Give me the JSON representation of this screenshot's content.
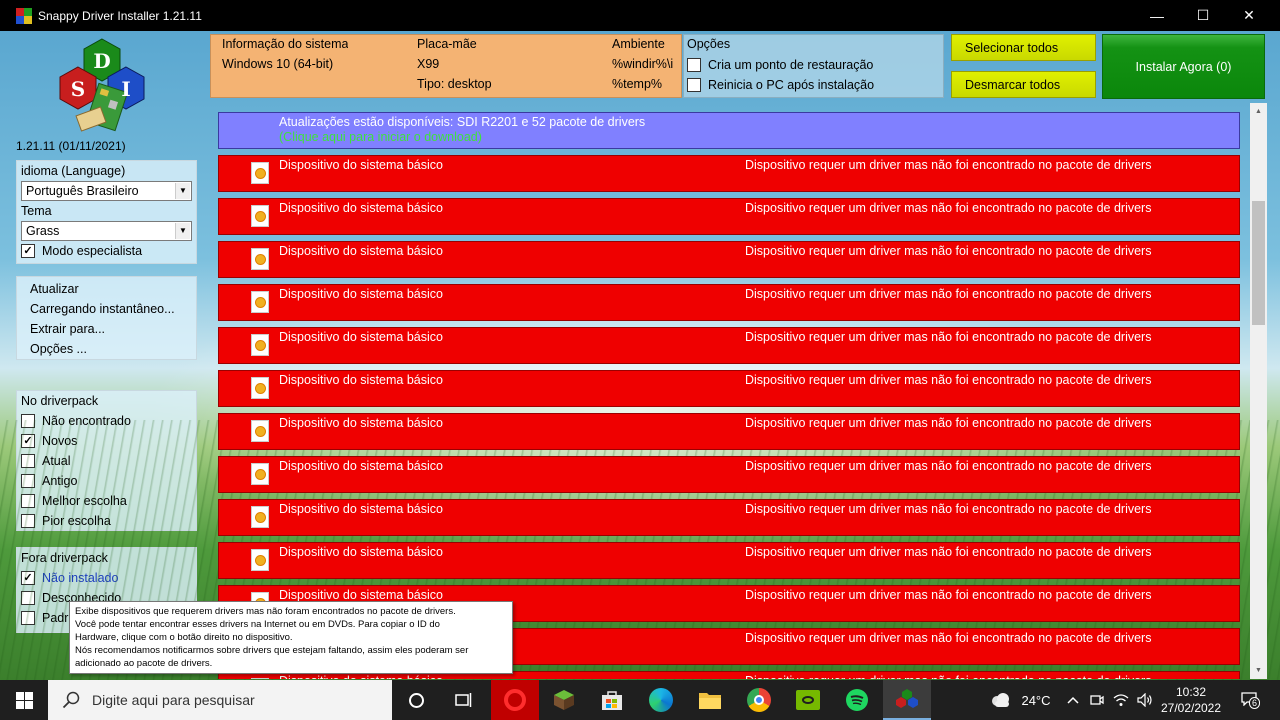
{
  "window": {
    "title": "Snappy Driver Installer 1.21.11",
    "minimize": "—",
    "maximize": "☐",
    "close": "✕"
  },
  "logo": {
    "letters": [
      "S",
      "D",
      "I"
    ]
  },
  "version": "1.21.11 (01/11/2021)",
  "language_panel": {
    "language_label": "idioma (Language)",
    "language_value": "Português Brasileiro",
    "theme_label": "Tema",
    "theme_value": "Grass",
    "expert_label": "Modo especialista",
    "expert_checked": true
  },
  "menu": [
    "Atualizar",
    "Carregando instantâneo...",
    "Extrair para...",
    "Opções ..."
  ],
  "driverpack_filter": {
    "title": "No driverpack",
    "items": [
      {
        "label": "Não encontrado",
        "checked": false
      },
      {
        "label": "Novos",
        "checked": true
      },
      {
        "label": "Atual",
        "checked": false
      },
      {
        "label": "Antigo",
        "checked": false
      },
      {
        "label": "Melhor escolha",
        "checked": false
      },
      {
        "label": "Pior escolha",
        "checked": false
      }
    ]
  },
  "outside_filter": {
    "title": "Fora driverpack",
    "items": [
      {
        "label": "Não instalado",
        "checked": true
      },
      {
        "label": "Desconhecido",
        "checked": false
      },
      {
        "label": "Padr",
        "checked": false
      }
    ]
  },
  "sysinfo": {
    "col1_header": "Informação do sistema",
    "col1_value": "Windows 10 (64-bit)",
    "col2_header": "Placa-mãe",
    "col2_value": "X99",
    "col2_type": "Tipo: desktop",
    "col3_header": "Ambiente",
    "col3_value1": "%windir%\\i",
    "col3_value2": "%temp%"
  },
  "options": {
    "title": "Opções",
    "restore_point": "Cria um ponto de restauração",
    "restart": "Reinicia o PC após instalação"
  },
  "buttons": {
    "select_all": "Selecionar todos",
    "deselect_all": "Desmarcar todos",
    "install": "Instalar Agora (0)"
  },
  "updates_banner": {
    "line1": "Atualizações estão disponíveis: SDI R2201 e 52 pacote de drivers",
    "line2": "(Clique aqui para iniciar o download)"
  },
  "devices": [
    {
      "name": "Dispositivo do sistema básico",
      "status": "Dispositivo requer um driver mas não foi encontrado no pacote de drivers"
    },
    {
      "name": "Dispositivo do sistema básico",
      "status": "Dispositivo requer um driver mas não foi encontrado no pacote de drivers"
    },
    {
      "name": "Dispositivo do sistema básico",
      "status": "Dispositivo requer um driver mas não foi encontrado no pacote de drivers"
    },
    {
      "name": "Dispositivo do sistema básico",
      "status": "Dispositivo requer um driver mas não foi encontrado no pacote de drivers"
    },
    {
      "name": "Dispositivo do sistema básico",
      "status": "Dispositivo requer um driver mas não foi encontrado no pacote de drivers"
    },
    {
      "name": "Dispositivo do sistema básico",
      "status": "Dispositivo requer um driver mas não foi encontrado no pacote de drivers"
    },
    {
      "name": "Dispositivo do sistema básico",
      "status": "Dispositivo requer um driver mas não foi encontrado no pacote de drivers"
    },
    {
      "name": "Dispositivo do sistema básico",
      "status": "Dispositivo requer um driver mas não foi encontrado no pacote de drivers"
    },
    {
      "name": "Dispositivo do sistema básico",
      "status": "Dispositivo requer um driver mas não foi encontrado no pacote de drivers"
    },
    {
      "name": "Dispositivo do sistema básico",
      "status": "Dispositivo requer um driver mas não foi encontrado no pacote de drivers"
    },
    {
      "name": "Dispositivo do sistema básico",
      "status": "Dispositivo requer um driver mas não foi encontrado no pacote de drivers"
    },
    {
      "name": "Dispositivo do sistema básico",
      "status": "Dispositivo requer um driver mas não foi encontrado no pacote de drivers"
    },
    {
      "name": "Dispositivo do sistema básico",
      "status": "Dispositivo requer um driver mas não foi encontrado no pacote de drivers"
    }
  ],
  "tooltip": {
    "lines": [
      "Exibe dispositivos que requerem drivers mas não foram encontrados no pacote de drivers.",
      "Você pode tentar encontrar esses drivers na Internet ou em DVDs. Para copiar o ID do",
      "Hardware, clique com o botão direito no dispositivo.",
      "Nós recomendamos notificarmos sobre drivers que estejam faltando, assim eles poderam ser",
      "adicionado ao pacote de drivers."
    ]
  },
  "taskbar": {
    "search_placeholder": "Digite aqui para pesquisar",
    "weather": "24°C",
    "time": "10:32",
    "date": "27/02/2022",
    "notifications": "6",
    "pinned": [
      "cortana-icon",
      "task-view-icon",
      "opera-icon",
      "minecraft-icon",
      "store-icon",
      "edge-icon",
      "file-explorer-icon",
      "chrome-icon",
      "nvidia-icon",
      "spotify-icon",
      "sdi-icon"
    ]
  },
  "colors": {
    "device_row": "#ef0000",
    "updates_banner": "#8080ff",
    "sysinfo": "#f4b373",
    "yellow_button": "#d8e800",
    "install_button": "#0b870b"
  }
}
